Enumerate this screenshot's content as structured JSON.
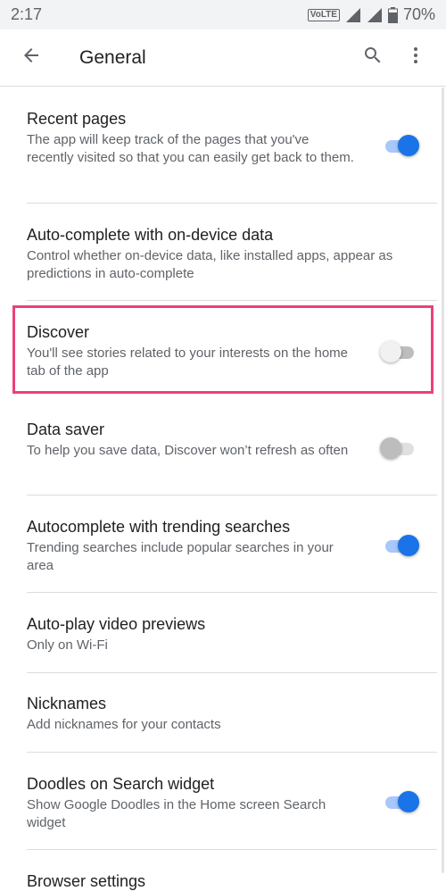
{
  "status_bar": {
    "time": "2:17",
    "network_badge": "VoLTE",
    "battery": "70%"
  },
  "app_bar": {
    "title": "General",
    "icons": [
      "back-arrow-icon",
      "search-icon",
      "more-vert-icon"
    ]
  },
  "colors": {
    "accent": "#1a73e8",
    "highlight": "#ec407a"
  },
  "settings": [
    {
      "title": "Recent pages",
      "desc": "The app will keep track of the pages that you've recently visited so that you can easily get back to them.",
      "toggle": "on"
    },
    {
      "title": "Auto-complete with on-device data",
      "desc": "Control whether on-device data, like installed apps, appear as predictions in auto-complete",
      "toggle": "none"
    },
    {
      "title": "Discover",
      "desc": "You'll see stories related to your interests on the home tab of the app",
      "toggle": "off"
    },
    {
      "title": "Data saver",
      "desc": "To help you save data, Discover won’t refresh as often",
      "toggle": "disabled"
    },
    {
      "title": "Autocomplete with trending searches",
      "desc": "Trending searches include popular searches in your area",
      "toggle": "on"
    },
    {
      "title": "Auto-play video previews",
      "desc": "Only on Wi-Fi",
      "toggle": "none"
    },
    {
      "title": "Nicknames",
      "desc": "Add nicknames for your contacts",
      "toggle": "none"
    },
    {
      "title": "Doodles on Search widget",
      "desc": "Show Google Doodles in the Home screen Search widget",
      "toggle": "on"
    },
    {
      "title": "Browser settings",
      "desc": "",
      "toggle": "none"
    }
  ]
}
